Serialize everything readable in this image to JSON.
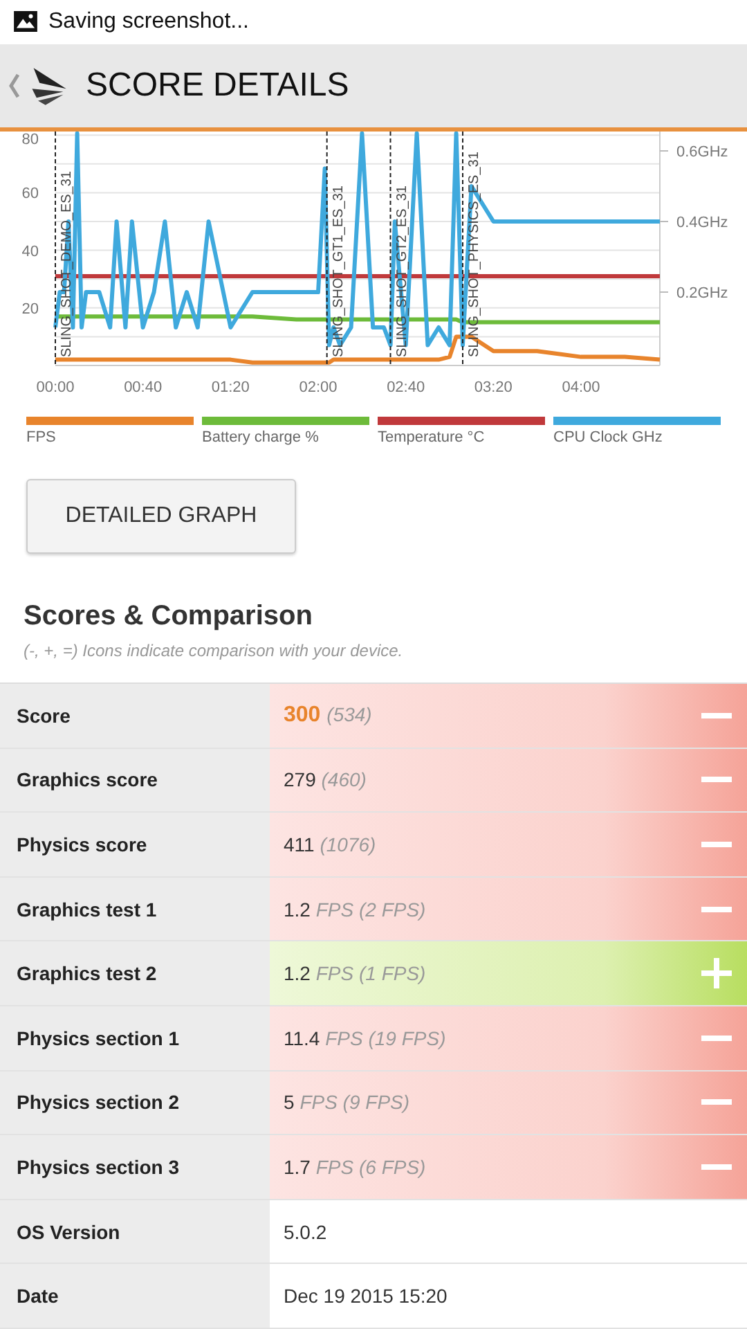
{
  "status_bar": {
    "text": "Saving screenshot..."
  },
  "header": {
    "title": "SCORE DETAILS"
  },
  "chart": {
    "chart_data": {
      "type": "line",
      "x": [
        0,
        2,
        4,
        6,
        8,
        10,
        12,
        14,
        20,
        25,
        28,
        32,
        35,
        40,
        45,
        50,
        55,
        60,
        65,
        70,
        80,
        90,
        110,
        120,
        123,
        125,
        127,
        130,
        135,
        140,
        145,
        150,
        153,
        155,
        160,
        165,
        170,
        175,
        180,
        183,
        186,
        190,
        200,
        220,
        240,
        260,
        276
      ],
      "xlim": [
        0,
        276
      ],
      "ylim": [
        0,
        80
      ],
      "xticks": [
        {
          "value": 0,
          "label": "00:00"
        },
        {
          "value": 40,
          "label": "00:40"
        },
        {
          "value": 80,
          "label": "01:20"
        },
        {
          "value": 120,
          "label": "02:00"
        },
        {
          "value": 160,
          "label": "02:40"
        },
        {
          "value": 200,
          "label": "03:20"
        },
        {
          "value": 240,
          "label": "04:00"
        }
      ],
      "yticks": [
        20,
        40,
        60,
        80
      ],
      "y2lim": [
        0,
        0.65
      ],
      "y2ticks": [
        {
          "value": 0.2,
          "label": "0.2GHz"
        },
        {
          "value": 0.4,
          "label": "0.4GHz"
        },
        {
          "value": 0.6,
          "label": "0.6GHz"
        }
      ],
      "series": [
        {
          "name": "FPS",
          "color": "#e8842c",
          "values": [
            2,
            2,
            2,
            2,
            2,
            2,
            2,
            2,
            2,
            2,
            2,
            2,
            2,
            2,
            2,
            2,
            2,
            2,
            2,
            2,
            2,
            1,
            1,
            1,
            1,
            1,
            2,
            2,
            2,
            2,
            2,
            2,
            2,
            2,
            2,
            2,
            2,
            2,
            3,
            10,
            10,
            10,
            5,
            5,
            3,
            3,
            2
          ]
        },
        {
          "name": "Battery charge %",
          "color": "#6dbb3a",
          "values": [
            17,
            17,
            17,
            17,
            17,
            17,
            17,
            17,
            17,
            17,
            17,
            17,
            17,
            17,
            17,
            17,
            17,
            17,
            17,
            17,
            17,
            17,
            16,
            16,
            16,
            16,
            16,
            16,
            16,
            16,
            16,
            16,
            16,
            16,
            16,
            16,
            16,
            16,
            16,
            16,
            15,
            15,
            15,
            15,
            15,
            15,
            15
          ]
        },
        {
          "name": "Temperature °C",
          "color": "#c0393b",
          "values": [
            31,
            31,
            31,
            31,
            31,
            31,
            31,
            31,
            31,
            31,
            31,
            31,
            31,
            31,
            31,
            31,
            31,
            31,
            31,
            31,
            31,
            31,
            31,
            31,
            31,
            31,
            31,
            31,
            31,
            31,
            31,
            31,
            31,
            31,
            31,
            31,
            31,
            31,
            31,
            31,
            31,
            31,
            31,
            31,
            31,
            31,
            31
          ]
        },
        {
          "name": "CPU Clock GHz",
          "color": "#3fa9dd",
          "axis": "y2",
          "values": [
            0.1,
            0.2,
            0.2,
            0.4,
            0.1,
            0.65,
            0.1,
            0.2,
            0.2,
            0.1,
            0.4,
            0.1,
            0.4,
            0.1,
            0.2,
            0.4,
            0.1,
            0.2,
            0.1,
            0.4,
            0.1,
            0.2,
            0.2,
            0.2,
            0.55,
            0.05,
            0.1,
            0.05,
            0.1,
            0.65,
            0.1,
            0.1,
            0.05,
            0.4,
            0.05,
            0.65,
            0.05,
            0.1,
            0.05,
            0.65,
            0.05,
            0.5,
            0.4,
            0.4,
            0.4,
            0.4,
            0.4
          ]
        }
      ],
      "grid": true,
      "ref_lines": [
        {
          "axis": "x",
          "value": 0,
          "label": "SLING_SHOT_DEMO_ES_31"
        },
        {
          "axis": "x",
          "value": 124,
          "label": "SLING_SHOT_GT1_ES_31"
        },
        {
          "axis": "x",
          "value": 153,
          "label": "SLING_SHOT_GT2_ES_31"
        },
        {
          "axis": "x",
          "value": 186,
          "label": "SLING_SHOT_PHYSICS_ES_31"
        }
      ]
    }
  },
  "detailed_graph_button": "DETAILED GRAPH",
  "comparison": {
    "title": "Scores & Comparison",
    "subtitle": "(-, +, =) Icons indicate comparison with your device.",
    "rows": [
      {
        "label": "Score",
        "value": "300",
        "detail": "(534)",
        "highlight": true,
        "kind": "worse"
      },
      {
        "label": "Graphics score",
        "value": "279",
        "detail": "(460)",
        "highlight": false,
        "kind": "worse"
      },
      {
        "label": "Physics score",
        "value": "411",
        "detail": "(1076)",
        "highlight": false,
        "kind": "worse"
      },
      {
        "label": "Graphics test 1",
        "value": "1.2",
        "detail": "FPS (2 FPS)",
        "highlight": false,
        "kind": "worse"
      },
      {
        "label": "Graphics test 2",
        "value": "1.2",
        "detail": "FPS (1 FPS)",
        "highlight": false,
        "kind": "better"
      },
      {
        "label": "Physics section 1",
        "value": "11.4",
        "detail": "FPS (19 FPS)",
        "highlight": false,
        "kind": "worse"
      },
      {
        "label": "Physics section 2",
        "value": "5",
        "detail": "FPS (9 FPS)",
        "highlight": false,
        "kind": "worse"
      },
      {
        "label": "Physics section 3",
        "value": "1.7",
        "detail": "FPS (6 FPS)",
        "highlight": false,
        "kind": "worse"
      },
      {
        "label": "OS Version",
        "value": "5.0.2",
        "highlight": false,
        "kind": "info"
      },
      {
        "label": "Date",
        "value": "Dec 19 2015 15:20",
        "highlight": false,
        "kind": "info"
      }
    ]
  }
}
